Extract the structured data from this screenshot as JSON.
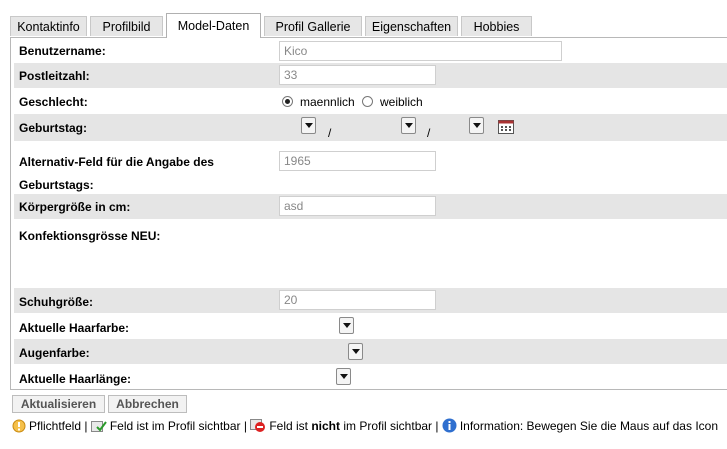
{
  "tabs": [
    "Kontaktinfo",
    "Profilbild",
    "Model-Daten",
    "Profil Gallerie",
    "Eigenschaften",
    "Hobbies"
  ],
  "active_tab": "Model-Daten",
  "form": {
    "benutzername": {
      "label": "Benutzername:",
      "value": "Kico"
    },
    "postleitzahl": {
      "label": "Postleitzahl:",
      "value": "33"
    },
    "geschlecht": {
      "label": "Geschlecht:",
      "options": [
        "maennlich",
        "weiblich"
      ],
      "selected": "maennlich"
    },
    "geburtstag": {
      "label": "Geburtstag:",
      "separator": "/"
    },
    "alternativ": {
      "label_line1": "Alternativ-Feld für die Angabe des",
      "label_line2": "Geburtstags:",
      "value": "1965"
    },
    "koerpergroesse": {
      "label": "Körpergröße in cm:",
      "value": "asd"
    },
    "konfektion": {
      "label": "Konfektionsgrösse NEU:"
    },
    "schuhgroesse": {
      "label": "Schuhgröße:",
      "value": "20"
    },
    "haarfarbe": {
      "label": "Aktuelle Haarfarbe:"
    },
    "augenfarbe": {
      "label": "Augenfarbe:"
    },
    "haarlaenge": {
      "label": "Aktuelle Haarlänge:"
    }
  },
  "buttons": {
    "update": "Aktualisieren",
    "cancel": "Abbrechen"
  },
  "legend": {
    "required": "Pflichtfeld |",
    "visible": "Feld ist im Profil sichtbar |",
    "hidden_pre": "Feld ist ",
    "hidden_bold": "nicht",
    "hidden_post": " im Profil sichtbar |",
    "info": "Information: Bewegen Sie die Maus auf das Icon"
  },
  "icons": [
    "required-icon",
    "visible-icon",
    "hidden-icon",
    "info-icon",
    "calendar-icon",
    "dropdown-arrow-icon"
  ]
}
